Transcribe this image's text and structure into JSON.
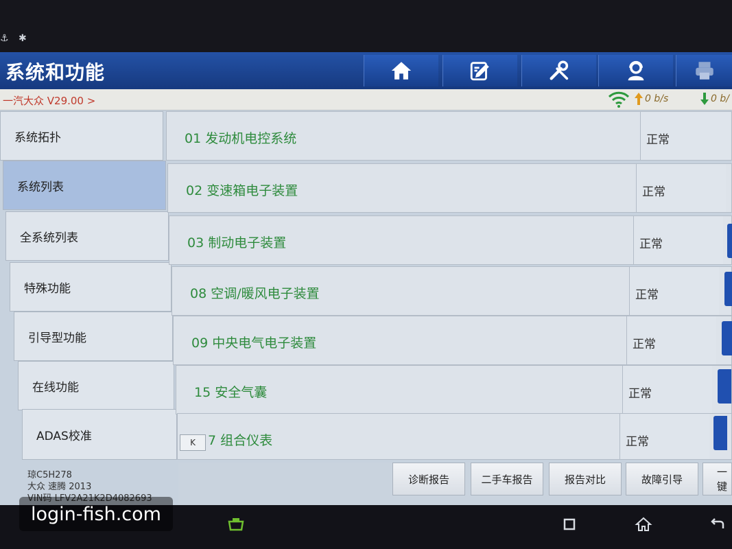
{
  "app": {
    "title": "系统和功能",
    "brand_version": "一汽大众 V29.00 >"
  },
  "network": {
    "upload": "0 b/s",
    "download": "0 b/"
  },
  "toolbar": [
    {
      "icon": "home-icon"
    },
    {
      "icon": "edit-report-icon"
    },
    {
      "icon": "tools-icon"
    },
    {
      "icon": "support-person-icon"
    },
    {
      "icon": "print-icon"
    }
  ],
  "sidebar": {
    "items": [
      {
        "label": "系统拓扑",
        "active": false
      },
      {
        "label": "系统列表",
        "active": true
      },
      {
        "label": "全系统列表",
        "active": false
      },
      {
        "label": "特殊功能",
        "active": false
      },
      {
        "label": "引导型功能",
        "active": false
      },
      {
        "label": "在线功能",
        "active": false
      },
      {
        "label": "ADAS校准",
        "active": false
      }
    ]
  },
  "systems": [
    {
      "name": "01 发动机电控系统",
      "status": "正常"
    },
    {
      "name": "02 变速箱电子装置",
      "status": "正常"
    },
    {
      "name": "03 制动电子装置",
      "status": "正常"
    },
    {
      "name": "08 空调/暖风电子装置",
      "status": "正常"
    },
    {
      "name": "09 中央电气电子装置",
      "status": "正常"
    },
    {
      "name": "15 安全气囊",
      "status": "正常"
    },
    {
      "name": "7 组合仪表",
      "status": "正常"
    }
  ],
  "vehicle": {
    "plate": "琼C5H278",
    "model": "大众 速腾 2013",
    "vin": "VIN码 LFV2A21K2D4082693"
  },
  "collapse_button": "K",
  "bottom_buttons": [
    "诊断报告",
    "二手车报告",
    "报告对比",
    "故障引导",
    "一键"
  ],
  "watermark": "login-fish.com",
  "colors": {
    "title_bar": "#1e4a9c",
    "system_name": "#2e8b3d",
    "active_tab": "#a8bedf",
    "brand_version": "#c0392b"
  }
}
